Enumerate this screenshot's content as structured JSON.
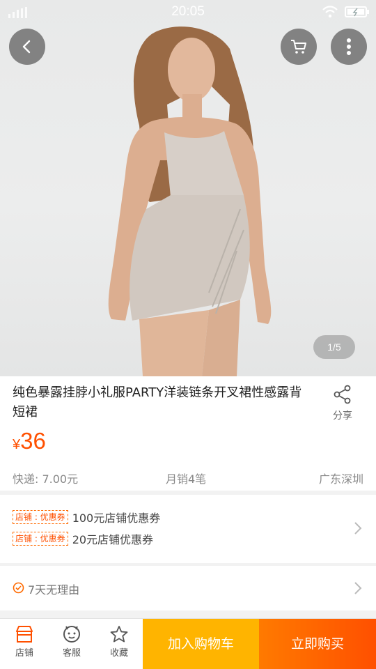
{
  "status_bar": {
    "time": "20:05"
  },
  "gallery": {
    "page_indicator": "1/5"
  },
  "product": {
    "title": "纯色暴露挂脖小礼服PARTY洋装链条开叉裙性感露背短裙",
    "share_label": "分享",
    "price_currency": "¥",
    "price_value": "36",
    "shipping": "快递: 7.00元",
    "monthly_sales": "月销4笔",
    "location": "广东深圳"
  },
  "coupons": [
    {
      "tag": "店铺 : 优惠券",
      "text": "100元店铺优惠券"
    },
    {
      "tag": "店铺 : 优惠券",
      "text": "20元店铺优惠券"
    }
  ],
  "guarantee": {
    "text": "7天无理由"
  },
  "bottom_bar": {
    "store_label": "店铺",
    "service_label": "客服",
    "favorite_label": "收藏",
    "add_to_cart_label": "加入购物车",
    "buy_now_label": "立即购买"
  },
  "colors": {
    "accent": "#ff5000",
    "cart_button": "#ffb400",
    "buy_button": "#ff5000"
  },
  "icons": [
    "signal-icon",
    "wifi-icon",
    "battery-icon",
    "back-icon",
    "cart-icon",
    "more-icon",
    "share-icon",
    "chevron-right-icon",
    "check-circle-icon",
    "store-icon",
    "customer-service-icon",
    "star-icon"
  ]
}
